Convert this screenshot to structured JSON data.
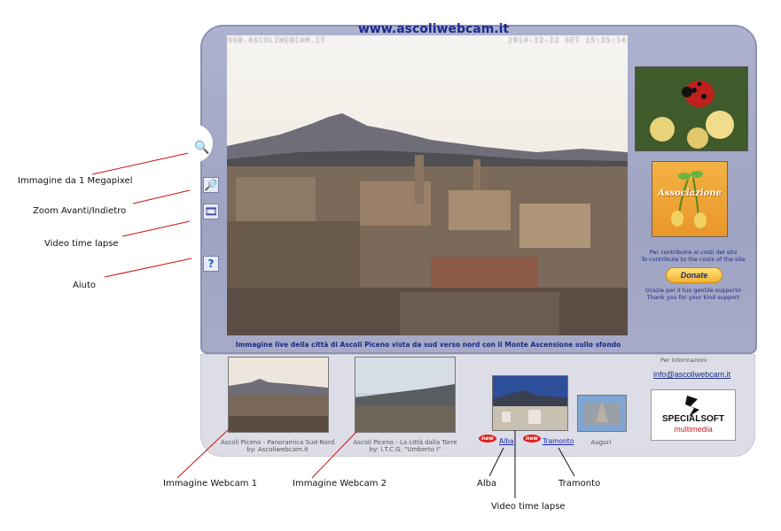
{
  "header": {
    "site_title": "www.ascoliwebcam.it"
  },
  "webcam": {
    "stamp_left": "SGN.ASCOLIWEBCAM.IT",
    "stamp_right": "2014-12-22 SET 15:35:14",
    "caption": "Immagine live della città di Ascoli Piceno vista da sud verso nord con il Monte Ascensione sullo sfondo"
  },
  "tools": [
    {
      "name": "magnifier-icon",
      "glyph": "🔍"
    },
    {
      "name": "zoom-icon",
      "glyph": "🔎"
    },
    {
      "name": "video-icon",
      "glyph": "🎞"
    },
    {
      "name": "help-icon",
      "glyph": "?"
    }
  ],
  "sidebar": {
    "association_label": "Associazione",
    "contribute_it": "Per contribuire ai costi del sito",
    "contribute_en": "To contribute to the costs of the site",
    "donate_label": "Donate",
    "thanks_it": "Grazie per il tuo gentile supporto",
    "thanks_en": "Thank you for your kind support"
  },
  "thumbs": {
    "cam1_line1": "Ascoli Piceno - Panoramica Sud-Nord",
    "cam1_line2": "by: Ascoliwebcam.it",
    "cam2_line1": "Ascoli Piceno - La città dalla Torre",
    "cam2_line2": "by: I.T.C.G. \"Umberto I\"",
    "new_badge": "new",
    "alba": "Alba",
    "tramonto": "Tramonto",
    "auguri": "Auguri"
  },
  "info": {
    "label": "Per Informazioni",
    "email": "info@ascoliwebcam.it",
    "brand_main": "SPECIALSOFT",
    "brand_sub": "multimedia"
  },
  "annotations": {
    "megapixel": "Immagine da 1 Megapixel",
    "zoom": "Zoom Avanti/Indietro",
    "video": "Video time lapse",
    "help": "Aiuto",
    "webcam1": "Immagine Webcam 1",
    "webcam2": "Immagine Webcam 2",
    "alba": "Alba",
    "tramonto": "Tramonto",
    "video_bottom": "Video time lapse"
  },
  "colors": {
    "accent": "#1b2a84",
    "frame": "#a4a8c6",
    "annotation_line": "#cc1111"
  }
}
